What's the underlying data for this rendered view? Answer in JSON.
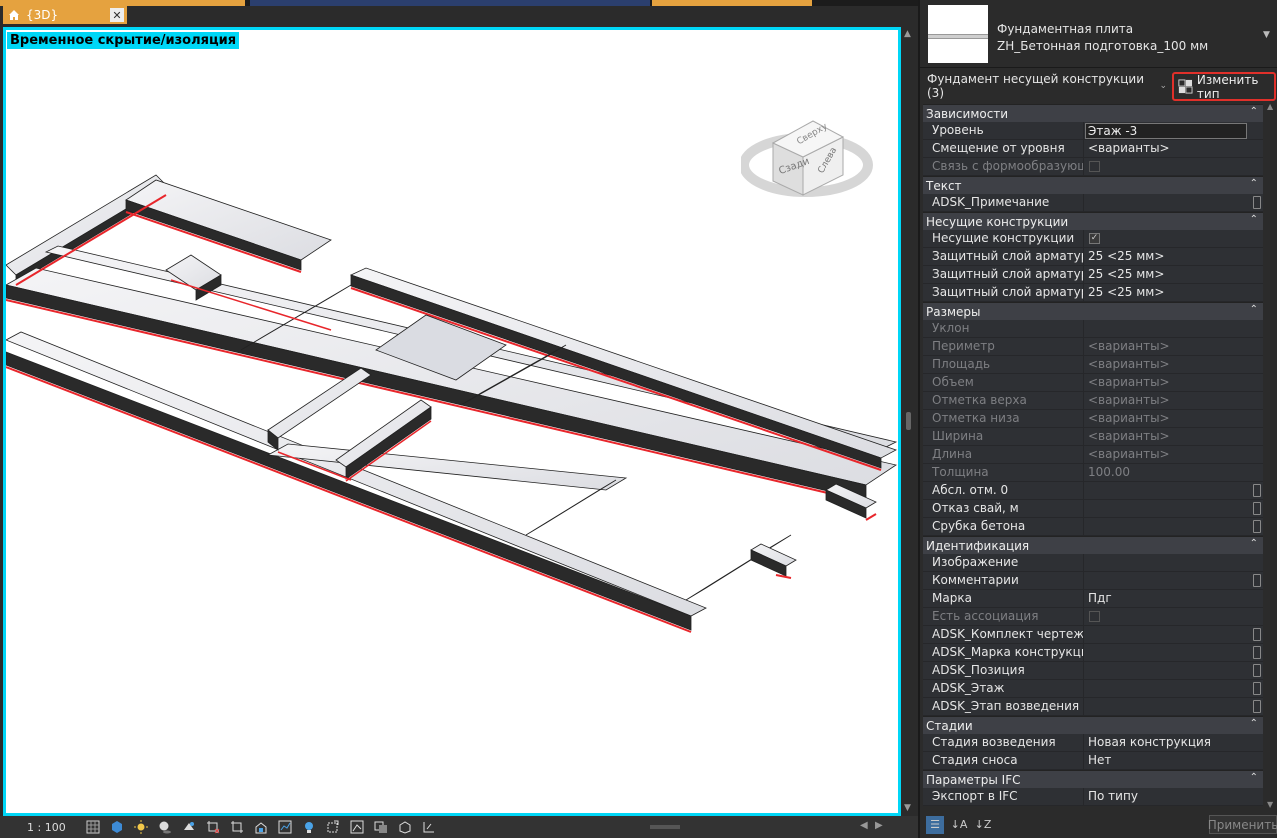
{
  "view": {
    "tab_label": "{3D}",
    "isolation_label": "Временное скрытие/изоляция",
    "scale": "1 : 100"
  },
  "type_selector": {
    "line1": "Фундаментная плита",
    "line2": "ZH_Бетонная  подготовка_100 мм"
  },
  "instance_filter": "Фундамент несущей конструкции (3)",
  "edit_type_label": "Изменить тип",
  "apply_label": "Применить",
  "colors": {
    "accent": "#00d7f7",
    "tab": "#e5a23f",
    "highlight_border": "#e0302a",
    "edge_red": "#e8262b"
  },
  "groups": [
    {
      "name": "Зависимости",
      "rows": [
        {
          "key": "Уровень",
          "value": "Этаж -3",
          "kind": "input"
        },
        {
          "key": "Смещение от уровня",
          "value": "<варианты>"
        },
        {
          "key": "Связь с формообразующ...",
          "value": "",
          "kind": "checkbox-disabled",
          "dim_key": true
        }
      ]
    },
    {
      "name": "Текст",
      "rows": [
        {
          "key": "ADSK_Примечание",
          "value": "",
          "kind": "edit"
        }
      ]
    },
    {
      "name": "Несущие конструкции",
      "rows": [
        {
          "key": "Несущие конструкции",
          "value": "",
          "kind": "checkbox-checked"
        },
        {
          "key": "Защитный слой арматур...",
          "value": "25 <25 мм>"
        },
        {
          "key": "Защитный слой арматур...",
          "value": "25 <25 мм>"
        },
        {
          "key": "Защитный слой арматур...",
          "value": "25 <25 мм>"
        }
      ]
    },
    {
      "name": "Размеры",
      "rows": [
        {
          "key": "Уклон",
          "value": "",
          "dim": true
        },
        {
          "key": "Периметр",
          "value": "<варианты>",
          "dim": true
        },
        {
          "key": "Площадь",
          "value": "<варианты>",
          "dim": true
        },
        {
          "key": "Объем",
          "value": "<варианты>",
          "dim": true
        },
        {
          "key": "Отметка верха",
          "value": "<варианты>",
          "dim": true
        },
        {
          "key": "Отметка низа",
          "value": "<варианты>",
          "dim": true
        },
        {
          "key": "Ширина",
          "value": "<варианты>",
          "dim": true
        },
        {
          "key": "Длина",
          "value": "<варианты>",
          "dim": true
        },
        {
          "key": "Толщина",
          "value": "100.00",
          "dim": true
        },
        {
          "key": "Абсл. отм. 0",
          "value": "",
          "kind": "edit"
        },
        {
          "key": "Отказ свай, м",
          "value": "",
          "kind": "edit"
        },
        {
          "key": "Срубка бетона",
          "value": "",
          "kind": "edit"
        }
      ]
    },
    {
      "name": "Идентификация",
      "rows": [
        {
          "key": "Изображение",
          "value": ""
        },
        {
          "key": "Комментарии",
          "value": "",
          "kind": "edit"
        },
        {
          "key": "Марка",
          "value": "Пдг"
        },
        {
          "key": "Есть ассоциация",
          "value": "",
          "kind": "checkbox-disabled",
          "dim_key": true
        },
        {
          "key": "ADSK_Комплект чертежей",
          "value": "",
          "kind": "edit"
        },
        {
          "key": "ADSK_Марка конструкции",
          "value": "",
          "kind": "edit"
        },
        {
          "key": "ADSK_Позиция",
          "value": "",
          "kind": "edit"
        },
        {
          "key": "ADSK_Этаж",
          "value": "",
          "kind": "edit"
        },
        {
          "key": "ADSK_Этап возведения",
          "value": "",
          "kind": "edit"
        }
      ]
    },
    {
      "name": "Стадии",
      "rows": [
        {
          "key": "Стадия возведения",
          "value": "Новая конструкция"
        },
        {
          "key": "Стадия сноса",
          "value": "Нет"
        }
      ]
    },
    {
      "name": "Параметры IFC",
      "rows": [
        {
          "key": "Экспорт в IFC",
          "value": "По типу"
        }
      ]
    }
  ],
  "viewcube": {
    "left_face": "Сзади",
    "right_face": "Слева",
    "top_face": "Сверху"
  },
  "status_icons": [
    "detail-level-icon",
    "visual-style-icon",
    "sun-path-icon",
    "shadows-icon",
    "render-icon",
    "crop-view-icon",
    "crop-region-icon",
    "unlock-3d-icon",
    "temporary-hide-icon",
    "reveal-hidden-icon",
    "highlight-displacement-icon",
    "analytical-model-icon",
    "worksharing-icon",
    "design-options-icon",
    "constraints-icon",
    "reveal-constraints-icon"
  ]
}
